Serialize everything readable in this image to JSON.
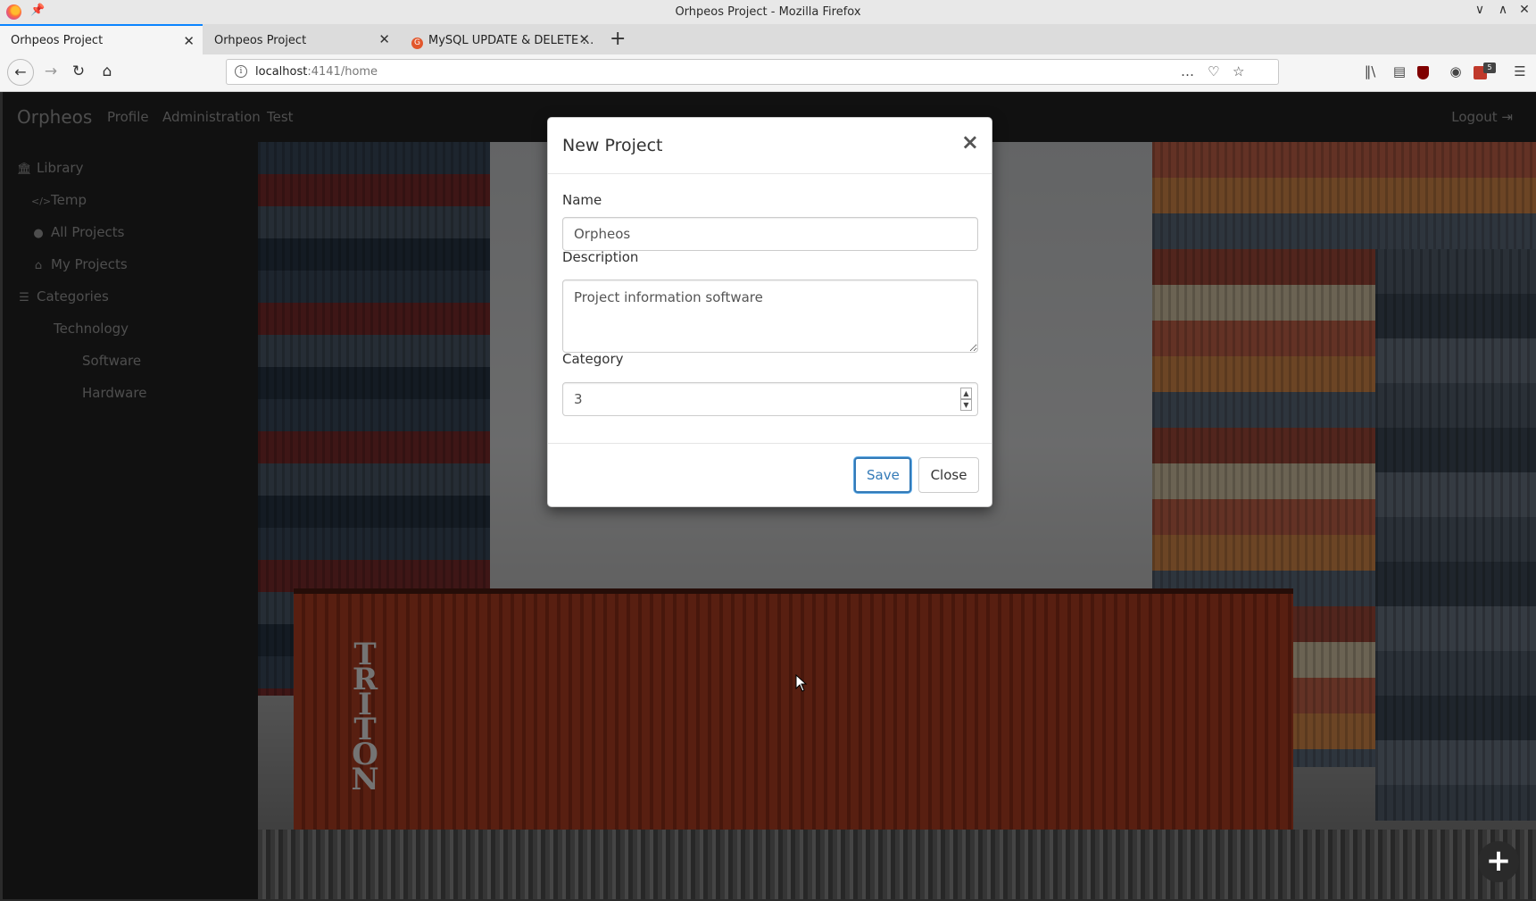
{
  "window": {
    "title": "Orhpeos Project - Mozilla Firefox"
  },
  "tabs": [
    {
      "label": "Orhpeos Project",
      "active": true
    },
    {
      "label": "Orhpeos Project",
      "active": false
    },
    {
      "label": "MySQL UPDATE & DELETE …",
      "active": false
    }
  ],
  "addressbar": {
    "host": "localhost",
    "port_path": ":4141/home"
  },
  "toolbar": {
    "notification_badge": "5"
  },
  "app": {
    "brand": "Orpheos",
    "nav": [
      "Profile",
      "Administration",
      "Test"
    ],
    "logout": "Logout",
    "sidebar": [
      {
        "label": "Library",
        "icon": "bank-icon",
        "glyph": "⌂"
      },
      {
        "label": "Temp",
        "icon": "code-icon",
        "glyph": "</>"
      },
      {
        "label": "All Projects",
        "icon": "globe-icon",
        "glyph": "●"
      },
      {
        "label": "My Projects",
        "icon": "home-icon",
        "glyph": "⌂"
      },
      {
        "label": "Categories",
        "icon": "list-icon",
        "glyph": "☰"
      },
      {
        "label": "Technology",
        "icon": "",
        "glyph": ""
      },
      {
        "label": "Software",
        "icon": "",
        "glyph": ""
      },
      {
        "label": "Hardware",
        "icon": "",
        "glyph": ""
      }
    ],
    "hero_text": "TRITON"
  },
  "modal": {
    "title": "New Project",
    "close_glyph": "×",
    "name_label": "Name",
    "name_value": "Orpheos",
    "description_label": "Description",
    "description_value": "Project information software",
    "category_label": "Category",
    "category_value": "3",
    "save_label": "Save",
    "close_label": "Close"
  },
  "colors": {
    "accent": "#337ab7",
    "nav_bg": "#222222",
    "tab_highlight": "#0a84ff"
  }
}
